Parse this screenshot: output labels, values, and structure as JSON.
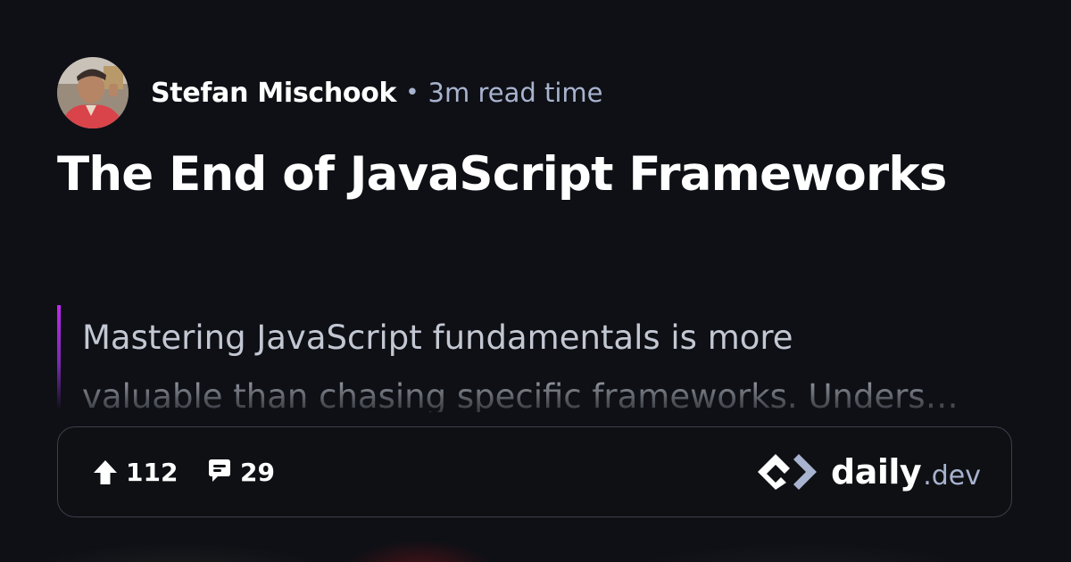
{
  "author": {
    "name": "Stefan Mischook",
    "separator": "•",
    "read_time": "3m read time"
  },
  "post": {
    "title": "The End of JavaScript Frameworks",
    "excerpt_lines": [
      "Mastering JavaScript fundamentals is more",
      "valuable than chasing specific frameworks. Unders…"
    ]
  },
  "stats": {
    "upvotes": "112",
    "comments": "29"
  },
  "brand": {
    "daily": "daily",
    "dev": ".dev"
  },
  "colors": {
    "background": "#0e1015",
    "accent_bar": "#c029f0",
    "muted_text": "#a8b3cf",
    "card_border": "#3a3f4a"
  },
  "icons": {
    "upvote": "arrow-up-icon",
    "comments": "comment-bubble-icon",
    "logo": "daily-dev-logo-icon"
  }
}
